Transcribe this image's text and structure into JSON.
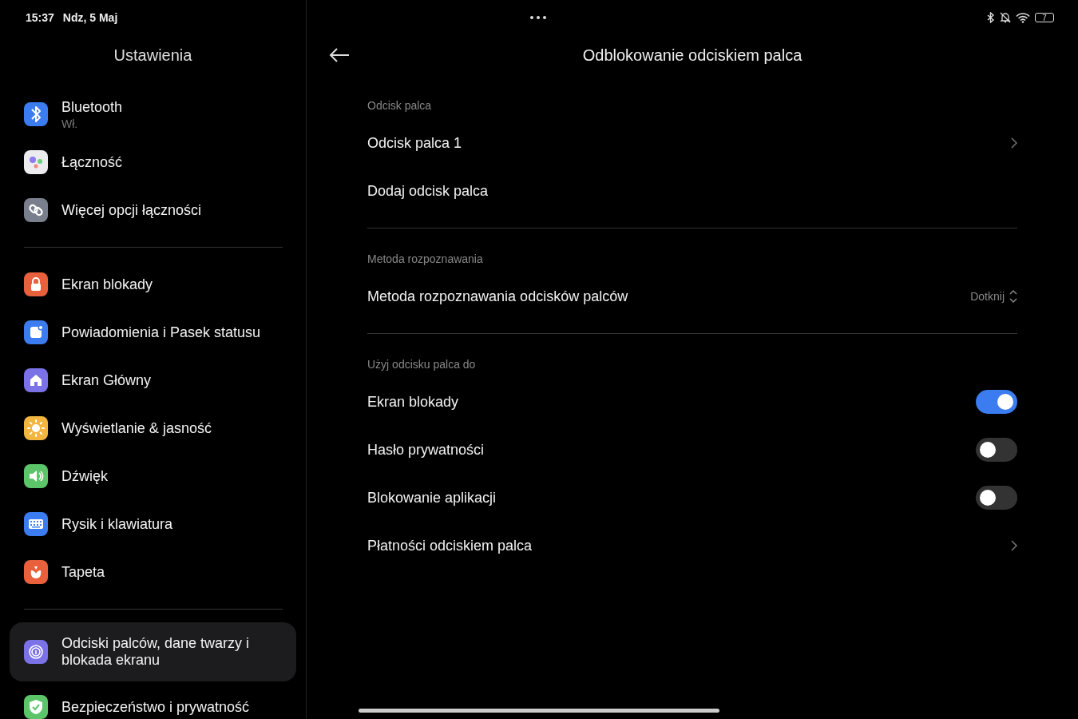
{
  "status_bar": {
    "time": "15:37",
    "date": "Ndz, 5 Maj",
    "battery": "7"
  },
  "sidebar": {
    "title": "Ustawienia",
    "groups": [
      {
        "items": [
          {
            "kind": "bluetooth",
            "label": "Bluetooth",
            "subtitle": "Wł.",
            "selected": false
          },
          {
            "kind": "connectivity",
            "label": "Łączność",
            "selected": false
          },
          {
            "kind": "link",
            "label": "Więcej opcji łączności",
            "selected": false
          }
        ]
      },
      {
        "items": [
          {
            "kind": "lock",
            "label": "Ekran blokady",
            "selected": false
          },
          {
            "kind": "notification",
            "label": "Powiadomienia i Pasek statusu",
            "selected": false
          },
          {
            "kind": "home",
            "label": "Ekran Główny",
            "selected": false
          },
          {
            "kind": "sun",
            "label": "Wyświetlanie & jasność",
            "selected": false
          },
          {
            "kind": "speaker",
            "label": "Dźwięk",
            "selected": false
          },
          {
            "kind": "keyboard",
            "label": "Rysik i klawiatura",
            "selected": false
          },
          {
            "kind": "wallpaper",
            "label": "Tapeta",
            "selected": false
          }
        ]
      },
      {
        "items": [
          {
            "kind": "fingerprint",
            "label": "Odciski palców, dane twarzy i blokada ekranu",
            "selected": true
          },
          {
            "kind": "shield",
            "label": "Bezpieczeństwo i prywatność",
            "selected": false
          }
        ]
      }
    ]
  },
  "detail": {
    "title": "Odblokowanie odciskiem palca",
    "sections": [
      {
        "header": "Odcisk palca",
        "rows": [
          {
            "kind": "link",
            "label": "Odcisk palca 1"
          },
          {
            "kind": "plain",
            "label": "Dodaj odcisk palca"
          }
        ]
      },
      {
        "header": "Metoda rozpoznawania",
        "rows": [
          {
            "kind": "select",
            "label": "Metoda rozpoznawania odcisków palców",
            "value": "Dotknij"
          }
        ]
      },
      {
        "header": "Użyj odcisku palca do",
        "rows": [
          {
            "kind": "toggle",
            "label": "Ekran blokady",
            "on": true
          },
          {
            "kind": "toggle",
            "label": "Hasło prywatności",
            "on": false
          },
          {
            "kind": "toggle",
            "label": "Blokowanie aplikacji",
            "on": false
          },
          {
            "kind": "link",
            "label": "Płatności odciskiem palca"
          }
        ]
      }
    ]
  }
}
